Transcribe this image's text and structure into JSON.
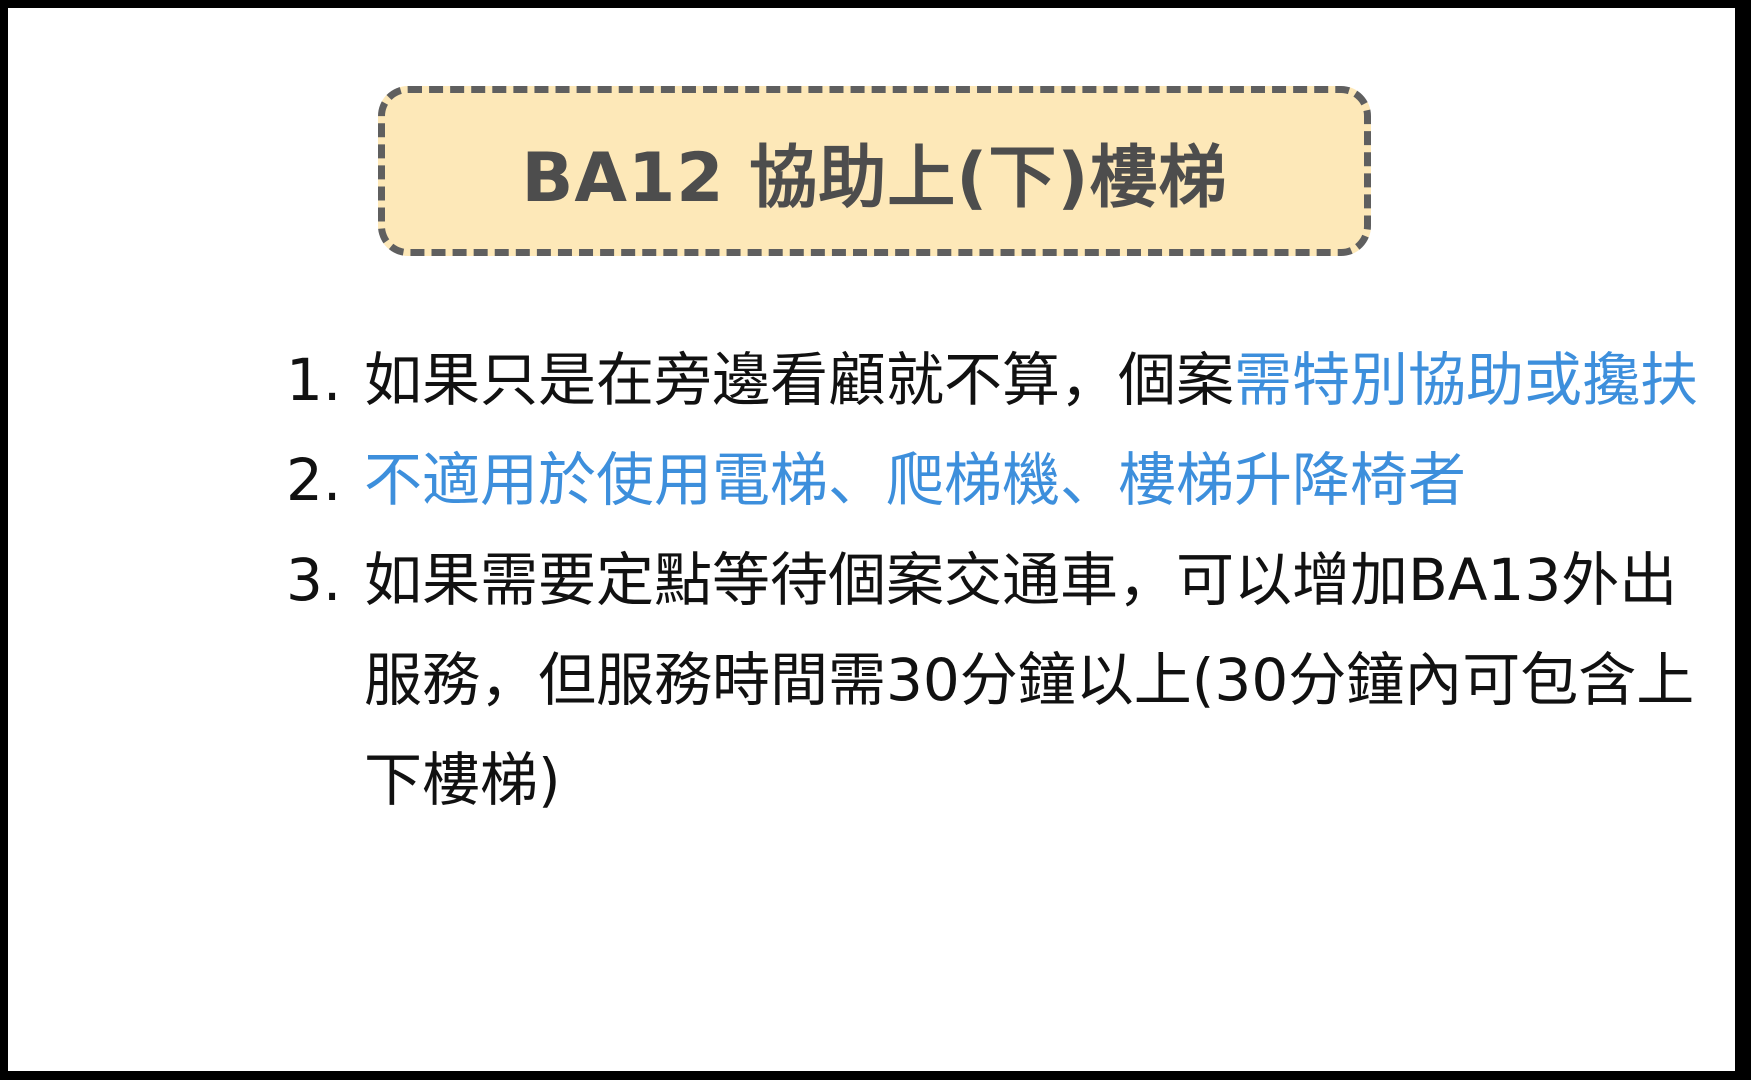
{
  "title": "BA12 協助上(下)樓梯",
  "items": [
    {
      "number": "1.",
      "text_plain": "如果只是在旁邊看顧就不算，個案",
      "text_highlight": "需特別協助或攙扶",
      "text_tail": ""
    },
    {
      "number": "2.",
      "text_plain": "",
      "text_highlight": "不適用於使用電梯、爬梯機、樓梯升降椅者",
      "text_tail": ""
    },
    {
      "number": "3.",
      "text_plain": "如果需要定點等待個案交通車，可以增加BA13外出服務，但服務時間需30分鐘以上(30分鐘內可包含上下樓梯)",
      "text_highlight": "",
      "text_tail": ""
    }
  ],
  "colors": {
    "title_box_fill": "#fde8b8",
    "title_box_border": "#5f5f5f",
    "title_text": "#4d4d4d",
    "body_text": "#111111",
    "highlight_text": "#3d8fdc",
    "frame": "#000000"
  }
}
